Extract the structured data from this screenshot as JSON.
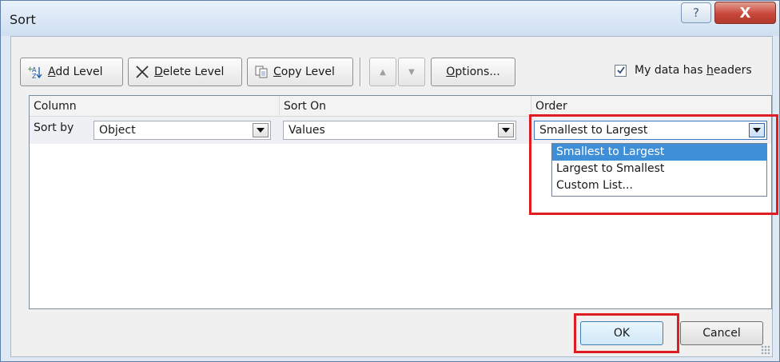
{
  "window": {
    "title": "Sort",
    "help_glyph": "?",
    "close_glyph": "X"
  },
  "toolbar": {
    "add_level": {
      "pre": "",
      "key": "A",
      "post": "dd Level"
    },
    "delete_level": {
      "pre": "",
      "key": "D",
      "post": "elete Level"
    },
    "copy_level": {
      "pre": "",
      "key": "C",
      "post": "opy Level"
    },
    "move_up_glyph": "▲",
    "move_down_glyph": "▼",
    "options": {
      "pre": "",
      "key": "O",
      "post": "ptions..."
    },
    "headers_checkbox": {
      "checked": true,
      "pre": "My data has ",
      "key": "h",
      "post": "eaders"
    }
  },
  "grid": {
    "columns": [
      "Column",
      "Sort On",
      "Order"
    ],
    "rows": [
      {
        "label": "Sort by",
        "column": "Object",
        "sort_on": "Values",
        "order": "Smallest to Largest"
      }
    ]
  },
  "order_dropdown": {
    "options": [
      "Smallest to Largest",
      "Largest to Smallest",
      "Custom List..."
    ],
    "selected_index": 0
  },
  "footer": {
    "ok": "OK",
    "cancel": "Cancel"
  },
  "colors": {
    "highlight": "#e11b22",
    "selection": "#3f8fd8",
    "title_bg": "#dfe9f5",
    "close_button": "#c8473a"
  },
  "icons": {
    "add_level": "add-sort-level-icon",
    "delete_level": "delete-x-icon",
    "copy_level": "copy-pages-icon",
    "checkbox": "checkmark-icon",
    "dropdown": "chevron-down-icon"
  }
}
